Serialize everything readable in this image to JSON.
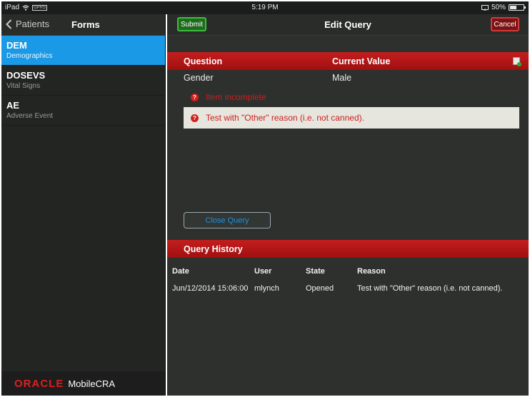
{
  "status_bar": {
    "device": "iPad",
    "wifi_icon": "wifi-icon",
    "carrier_icon": "sim-icon",
    "carrier_label": "GPRS",
    "time": "5:19 PM",
    "battery_percent": "50%",
    "battery_level": 0.5
  },
  "sidebar": {
    "back_label": "Patients",
    "title": "Forms",
    "items": [
      {
        "code": "DEM",
        "desc": "Demographics",
        "selected": true
      },
      {
        "code": "DOSEVS",
        "desc": "Vital Signs",
        "selected": false
      },
      {
        "code": "AE",
        "desc": "Adverse Event",
        "selected": false
      }
    ],
    "brand_oracle": "ORACLE",
    "brand_product": "MobileCRA"
  },
  "main": {
    "submit_label": "Submit",
    "title": "Edit Query",
    "cancel_label": "Cancel",
    "question_table": {
      "headers": [
        "Question",
        "Current Value"
      ],
      "rows": [
        {
          "question": "Gender",
          "value": "Male"
        }
      ]
    },
    "messages": [
      {
        "icon": "question-icon",
        "text": "Item incomplete"
      },
      {
        "icon": "question-icon",
        "text": "Test with \"Other\" reason (i.e. not canned)."
      }
    ],
    "close_query_label": "Close Query",
    "history": {
      "title": "Query History",
      "headers": [
        "Date",
        "User",
        "State",
        "Reason"
      ],
      "rows": [
        {
          "date": "Jun/12/2014 15:06:00",
          "user": "mlynch",
          "state": "Opened",
          "reason": "Test with \"Other\" reason (i.e. not canned)."
        }
      ]
    }
  },
  "colors": {
    "accent_blue": "#1a9ae6",
    "header_red": "#c41e1e",
    "submit_green": "#3bbf3b"
  }
}
